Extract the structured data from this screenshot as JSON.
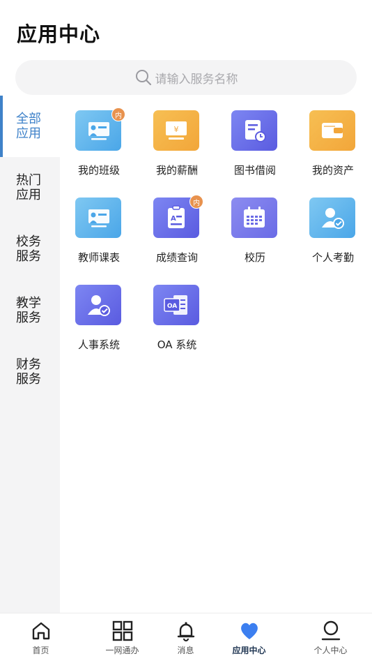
{
  "header": {
    "title": "应用中心"
  },
  "search": {
    "placeholder": "请输入服务名称",
    "icon": "search-icon"
  },
  "sidebar": {
    "active_index": 0,
    "items": [
      {
        "label": "全部\n应用"
      },
      {
        "label": "热门\n应用"
      },
      {
        "label": "校务\n服务"
      },
      {
        "label": "教学\n服务"
      },
      {
        "label": "财务\n服务"
      }
    ]
  },
  "apps": [
    {
      "name": "我的班级",
      "badge": "内",
      "icon": "classroom-board-icon",
      "color": "sky"
    },
    {
      "name": "我的薪酬",
      "badge": "",
      "icon": "salary-monitor-icon",
      "color": "orange"
    },
    {
      "name": "图书借阅",
      "badge": "",
      "icon": "book-clock-icon",
      "color": "purple"
    },
    {
      "name": "我的资产",
      "badge": "",
      "icon": "wallet-icon",
      "color": "orange"
    },
    {
      "name": "教师课表",
      "badge": "",
      "icon": "teacher-board-icon",
      "color": "sky"
    },
    {
      "name": "成绩查询",
      "badge": "内",
      "icon": "clipboard-grade-icon",
      "color": "purple"
    },
    {
      "name": "校历",
      "badge": "",
      "icon": "calendar-icon",
      "color": "violet"
    },
    {
      "name": "个人考勤",
      "badge": "",
      "icon": "person-check-icon",
      "color": "sky"
    },
    {
      "name": "人事系统",
      "badge": "",
      "icon": "person-check-icon",
      "color": "purple"
    },
    {
      "name": "OA 系统",
      "badge": "",
      "icon": "oa-document-icon",
      "color": "purple"
    }
  ],
  "tabbar": {
    "active_index": 3,
    "items": [
      {
        "label": "首页",
        "icon": "home-icon"
      },
      {
        "label": "一网通办",
        "icon": "grid-icon"
      },
      {
        "label": "消息",
        "icon": "bell-icon"
      },
      {
        "label": "应用中心",
        "icon": "heart-icon"
      },
      {
        "label": "个人中心",
        "icon": "user-icon"
      }
    ]
  },
  "colors": {
    "accent": "#3f82c9",
    "badge": "#e8924e",
    "tab_active": "#1f3552",
    "heart": "#3c7ff0"
  }
}
